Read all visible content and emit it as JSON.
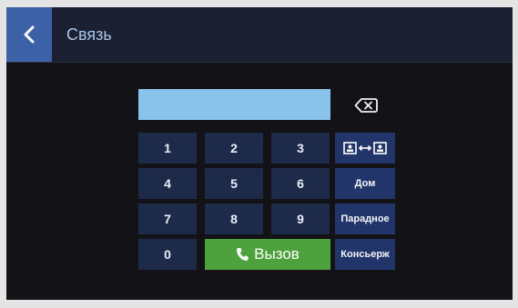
{
  "header": {
    "title": "Связь"
  },
  "keypad": {
    "k1": "1",
    "k2": "2",
    "k3": "3",
    "k4": "4",
    "k5": "5",
    "k6": "6",
    "k7": "7",
    "k8": "8",
    "k9": "9",
    "k0": "0"
  },
  "call": {
    "label": "Вызов"
  },
  "side": {
    "home": "Дом",
    "entrance": "Парадное",
    "concierge": "Консьерж"
  },
  "icons": {
    "back": "chevron-left-icon",
    "backspace": "backspace-icon",
    "transfer": "intercom-transfer-icon",
    "phone": "phone-icon"
  },
  "colors": {
    "accent": "#3c61a6",
    "display": "#89c2ea",
    "call": "#4da23e",
    "key": "#1e2a4a",
    "side_key": "#22356a"
  }
}
